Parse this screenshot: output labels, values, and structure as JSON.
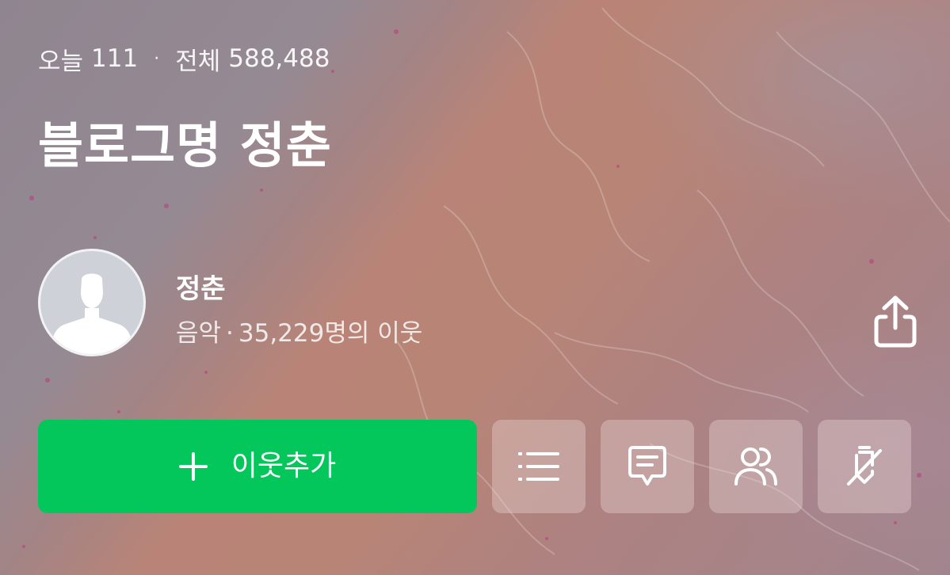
{
  "stats": {
    "today_label": "오늘",
    "today_count": "111",
    "separator": "·",
    "total_label": "전체",
    "total_count": "588,488"
  },
  "blog": {
    "title": "블로그명 정춘"
  },
  "profile": {
    "name": "정춘",
    "category": "음악",
    "separator": "·",
    "neighbors": "35,229명의 이웃",
    "avatar_icon": "default-avatar-icon"
  },
  "actions": {
    "follow_label": "이웃추가",
    "follow_icon": "plus-icon",
    "list_icon": "list-icon",
    "comment_icon": "comment-icon",
    "neighbors_icon": "people-icon",
    "write_off_icon": "pen-off-icon",
    "share_icon": "share-icon"
  },
  "colors": {
    "accent": "#03c75a",
    "text": "#ffffff",
    "action_bg": "#c9a6a6"
  }
}
